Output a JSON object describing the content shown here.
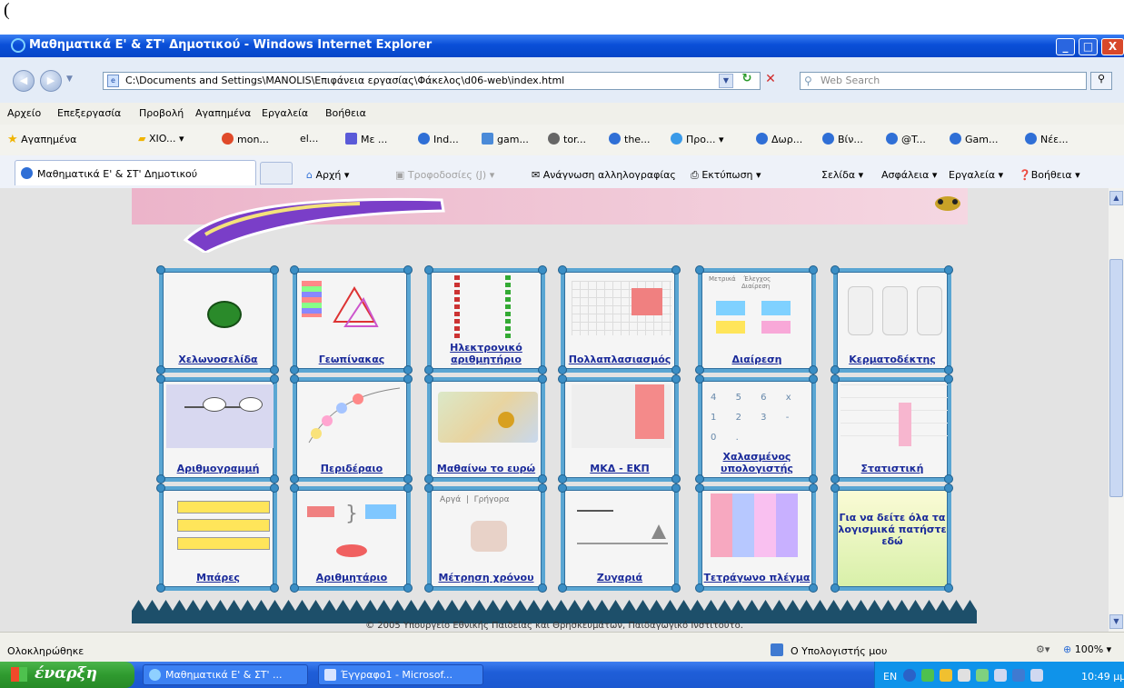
{
  "paren": "(",
  "window": {
    "title": "Μαθηματικά Ε' & ΣΤ' Δημοτικού - Windows Internet Explorer",
    "minimize": "_",
    "maximize": "□",
    "close": "X"
  },
  "address": {
    "url": "C:\\Documents and Settings\\MANOLIS\\Επιφάνεια εργασίας\\Φάκελος\\d06-web\\index.html",
    "search_placeholder": "Web Search"
  },
  "menu": [
    "Αρχείο",
    "Επεξεργασία",
    "Προβολή",
    "Αγαπημένα",
    "Εργαλεία",
    "Βοήθεια"
  ],
  "favorites": {
    "label": "Αγαπημένα",
    "items": [
      "XIO...",
      "mon...",
      "el...",
      "Με ...",
      "Ind...",
      "gam...",
      "tor...",
      "the...",
      "Προ...",
      "Δωρ...",
      "Βίν...",
      "@T...",
      "Gam...",
      "Νέε..."
    ]
  },
  "tab": {
    "title": "Μαθηματικά Ε' & ΣΤ' Δημοτικού"
  },
  "commands": {
    "home": "Αρχή",
    "feeds": "Τροφοδοσίες (J)",
    "read_mail": "Ανάγνωση αλληλογραφίας",
    "print": "Εκτύπωση",
    "page": "Σελίδα",
    "safety": "Ασφάλεια",
    "tools": "Εργαλεία",
    "help": "Βοήθεια"
  },
  "tiles": [
    [
      "Χελωνοσελίδα",
      "Γεωπίνακας",
      "Ηλεκτρονικό αριθμητήριο",
      "Πολλαπλασιασμός",
      "Διαίρεση",
      "Κερματοδέκτης"
    ],
    [
      "Αριθμογραμμή",
      "Περιδέραιο",
      "Μαθαίνω το ευρώ",
      "ΜΚΔ - ΕΚΠ",
      "Χαλασμένος υπολογιστής",
      "Στατιστική"
    ],
    [
      "Μπάρες",
      "Αριθμητάριο",
      "Μέτρηση χρόνου",
      "Ζυγαριά",
      "Τετράγωνο πλέγμα",
      "Για να δείτε όλα τα λογισμικά πατήστε εδώ"
    ]
  ],
  "tile_texts": {
    "division_labels": [
      "Μετρικά",
      "Έλεγχος",
      "Διαίρεση"
    ],
    "calc_keys": [
      "4",
      "5",
      "6",
      "x",
      "1",
      "2",
      "3",
      "-",
      "0",
      "."
    ],
    "time_labels": [
      "Αργά",
      "Γρήγορα"
    ]
  },
  "copyright": "© 2005 Υπουργείο Εθνικής Παιδείας και Θρησκευμάτων, Παιδαγωγικό Ινστιτούτο.",
  "status": {
    "text": "Ολοκληρώθηκε",
    "zone": "Ο Υπολογιστής μου",
    "zoom": "100%"
  },
  "taskbar": {
    "start": "έναρξη",
    "tasks": [
      "Μαθηματικά Ε' & ΣΤ' ...",
      "Έγγραφο1 - Microsof..."
    ],
    "lang": "EN",
    "clock": "10:49 μμ"
  }
}
